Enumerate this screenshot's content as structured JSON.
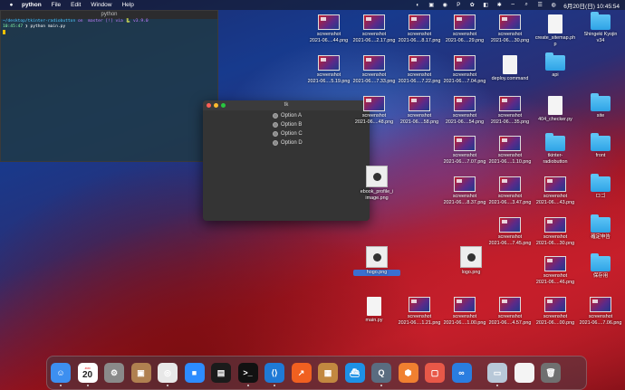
{
  "menubar": {
    "app_name": "python",
    "menus": [
      "File",
      "Edit",
      "Window",
      "Help"
    ],
    "datetime": "6月20日(日)  10:45:54"
  },
  "terminal": {
    "title": "python",
    "prompt_path": "~/desktop/tkinter-radiobutton",
    "prompt_branch": "on  master [!] via 🐍 v3.9.0",
    "time": "10:45:47",
    "command": "❯ python main.py"
  },
  "tk": {
    "title": "tk",
    "options": [
      "Option A",
      "Option B",
      "Option C",
      "Option D"
    ]
  },
  "desktop": {
    "items": [
      {
        "label": "screenshot\n2021-06....44.png",
        "kind": "thumb"
      },
      {
        "label": "screenshot\n2021-06....2.17.png",
        "kind": "thumb"
      },
      {
        "label": "screenshot\n2021-06....8.17.png",
        "kind": "thumb"
      },
      {
        "label": "screenshot\n2021-06....29.png",
        "kind": "thumb"
      },
      {
        "label": "screenshot\n2021-06....30.png",
        "kind": "thumb"
      },
      {
        "label": "create_sitemap.ph\np",
        "kind": "doc"
      },
      {
        "label": "Shingeki Kyojin\nv34",
        "kind": "folder"
      },
      {
        "label": "screenshot\n2021-06....5.19.png",
        "kind": "thumb"
      },
      {
        "label": "screenshot\n2021-06....7.33.png",
        "kind": "thumb"
      },
      {
        "label": "screenshot\n2021-06....7.22.png",
        "kind": "thumb"
      },
      {
        "label": "screenshot\n2021-06....7.04.png",
        "kind": "thumb"
      },
      {
        "label": "deploy.command",
        "kind": "doc"
      },
      {
        "label": "api",
        "kind": "folder"
      },
      {
        "label": "screenshot\n2021-06....48.png",
        "kind": "thumb"
      },
      {
        "label": "screenshot\n2021-06....58.png",
        "kind": "thumb"
      },
      {
        "label": "screenshot\n2021-06....54.png",
        "kind": "thumb"
      },
      {
        "label": "screenshot\n2021-06....35.png",
        "kind": "thumb"
      },
      {
        "label": "404_checker.py",
        "kind": "doc"
      },
      {
        "label": "site",
        "kind": "folder"
      },
      {
        "label": "screenshot\n2021-06....7.07.png",
        "kind": "thumb"
      },
      {
        "label": "screenshot\n2021-06....1.10.png",
        "kind": "thumb"
      },
      {
        "label": "tkinter-\nradiobutton",
        "kind": "folder"
      },
      {
        "label": "front",
        "kind": "folder"
      },
      {
        "label": "ebook_profile_i\nimage.png",
        "kind": "pimg"
      },
      {
        "label": "screenshot\n2021-06....8.37.png",
        "kind": "thumb"
      },
      {
        "label": "screenshot\n2021-06....3.47.png",
        "kind": "thumb"
      },
      {
        "label": "screenshot\n2021-06....43.png",
        "kind": "thumb"
      },
      {
        "label": "ロゴ",
        "kind": "folder"
      },
      {
        "label": "screenshot\n2021-06....7.45.png",
        "kind": "thumb"
      },
      {
        "label": "screenshot\n2021-06....30.png",
        "kind": "thumb"
      },
      {
        "label": "確定申告",
        "kind": "folder"
      },
      {
        "label": "hogo.png",
        "kind": "pimg"
      },
      {
        "label": "logo.png",
        "kind": "pimg"
      },
      {
        "label": "screenshot\n2021-06....46.png",
        "kind": "thumb"
      },
      {
        "label": "保存用",
        "kind": "folder"
      },
      {
        "label": "screenshot\n2021-06....1.21.png",
        "kind": "thumb"
      },
      {
        "label": "screenshot\n2021-06....1.00.png",
        "kind": "thumb"
      },
      {
        "label": "screenshot\n2021-06....4.57.png",
        "kind": "thumb"
      },
      {
        "label": "screenshot\n2021-06....00.png",
        "kind": "thumb"
      },
      {
        "label": "screenshot\n2021-06....7.06.png",
        "kind": "thumb"
      },
      {
        "label": "main.py",
        "kind": "doc"
      }
    ]
  },
  "dock": {
    "calendar_day": "20",
    "apps": [
      {
        "name": "finder-icon",
        "color": "#3d8ff0",
        "glyph": "☺"
      },
      {
        "name": "calendar-icon",
        "color": "#ffffff",
        "glyph": ""
      },
      {
        "name": "system-preferences-icon",
        "color": "#8a8a8a",
        "glyph": "⚙"
      },
      {
        "name": "contacts-icon",
        "color": "#b08050",
        "glyph": "▣"
      },
      {
        "name": "chrome-icon",
        "color": "#e8e8e8",
        "glyph": "◎"
      },
      {
        "name": "zoom-icon",
        "color": "#2d8cff",
        "glyph": "■"
      },
      {
        "name": "activity-monitor-icon",
        "color": "#1b1b1b",
        "glyph": "▤"
      },
      {
        "name": "terminal-icon",
        "color": "#111111",
        "glyph": ">_"
      },
      {
        "name": "vscode-icon",
        "color": "#1f7ad6",
        "glyph": "⟨⟩"
      },
      {
        "name": "instruments-icon",
        "color": "#f06020",
        "glyph": "↗"
      },
      {
        "name": "archive-utility-icon",
        "color": "#c28840",
        "glyph": "▦"
      },
      {
        "name": "docker-icon",
        "color": "#1d91e6",
        "glyph": "⛴"
      },
      {
        "name": "quicktime-icon",
        "color": "#5a6c80",
        "glyph": "Q"
      },
      {
        "name": "sourcetree-icon",
        "color": "#f08030",
        "glyph": "⬢"
      },
      {
        "name": "preview-icon",
        "color": "#e85848",
        "glyph": "▢"
      },
      {
        "name": "infinity-icon",
        "color": "#2a7de0",
        "glyph": "∞"
      },
      {
        "name": "downloads-icon",
        "color": "#b8c8d8",
        "glyph": "▭"
      },
      {
        "name": "document-icon",
        "color": "#f4f4f4",
        "glyph": ""
      },
      {
        "name": "trash-icon",
        "color": "#707070",
        "glyph": "🗑"
      }
    ]
  }
}
